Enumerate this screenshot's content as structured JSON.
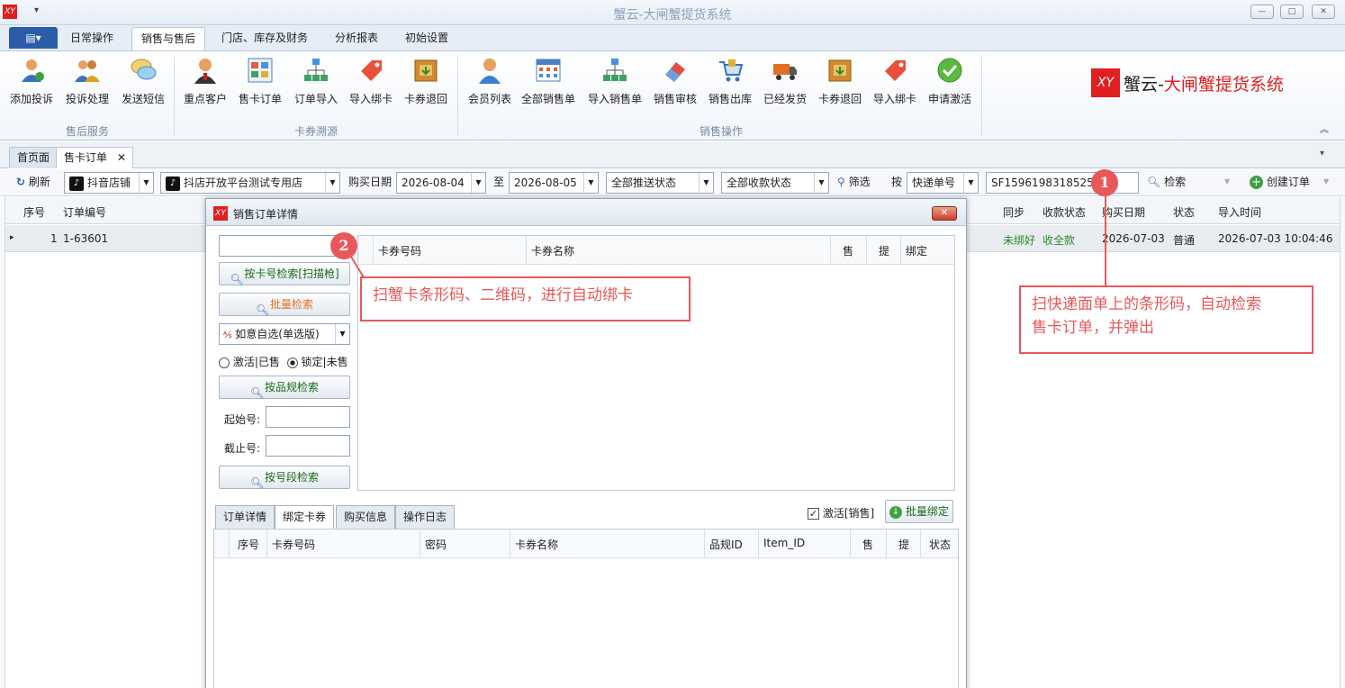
{
  "window": {
    "title": "蟹云-大闸蟹提货系统",
    "app_icon": "XY",
    "qa": "▾",
    "minimize": "—",
    "maximize": "□",
    "close": "✕"
  },
  "ribbon": {
    "file_label": "▤▾",
    "tabs": [
      "日常操作",
      "销售与售后",
      "门店、库存及财务",
      "分析报表",
      "初始设置"
    ],
    "active_tab": "销售与售后",
    "groups": [
      {
        "label": "售后服务",
        "buttons": [
          "添加投诉",
          "投诉处理",
          "发送短信"
        ]
      },
      {
        "label": "卡券溯源",
        "buttons": [
          "重点客户",
          "售卡订单",
          "订单导入",
          "导入绑卡",
          "卡券退回"
        ]
      },
      {
        "label": "销售操作",
        "buttons": [
          "会员列表",
          "全部销售单",
          "导入销售单",
          "销售审核",
          "销售出库",
          "已经发货",
          "卡券退回",
          "导入绑卡",
          "申请激活"
        ]
      }
    ],
    "brand_part1": "蟹云-",
    "brand_part2": "大闸蟹提货系统",
    "brand_logo": "XY",
    "collapse": "︽"
  },
  "doc_tabs": {
    "home": "首页面",
    "orders": "售卡订单",
    "close": "✕",
    "menu": "▾"
  },
  "filter": {
    "refresh": "刷新",
    "shop_type": "抖音店铺",
    "shop_name": "抖店开放平台测试专用店",
    "date_label": "购买日期",
    "date_from": "2026-08-04",
    "to_label": "至",
    "date_to": "2026-08-05",
    "push_status": "全部推送状态",
    "pay_status": "全部收款状态",
    "filter_btn": "筛选",
    "by_label": "按",
    "search_field": "快递单号",
    "search_value": "SF1596198318525",
    "search_btn": "检索",
    "create_btn": "创建订单"
  },
  "grid": {
    "headers": {
      "seq": "序号",
      "order_no": "订单编号",
      "sync": "同步",
      "pay": "收款状态",
      "date": "购买日期",
      "status": "状态",
      "import": "导入时间"
    },
    "rows": [
      {
        "marker": "▸",
        "seq": "1",
        "order_no": "1-63601",
        "sync": "未绑好",
        "pay": "收全款",
        "date": "2026-07-03",
        "status": "普通",
        "import": "2026-07-03 10:04:46"
      }
    ]
  },
  "dialog": {
    "title": "销售订单详情",
    "icon": "XY",
    "close": "✕",
    "search_card_btn": "按卡号检索[扫描枪]",
    "batch_search_btn": "批量检索",
    "product_select": "如意自选(单选版)",
    "radio_activated": "激活|已售",
    "radio_locked": "锁定|未售",
    "spec_search_btn": "按品规检索",
    "start_label": "起始号:",
    "end_label": "截止号:",
    "range_search_btn": "按号段检索",
    "top_table_headers": [
      "卡券号码",
      "卡券名称",
      "售",
      "提",
      "绑定"
    ],
    "bottom_tabs": [
      "订单详情",
      "绑定卡券",
      "购买信息",
      "操作日志"
    ],
    "active_bottom_tab": "绑定卡券",
    "activate_check": "激活[销售]",
    "batch_bind_btn": "批量绑定",
    "bottom_table_headers": [
      "序号",
      "卡券号码",
      "密码",
      "卡券名称",
      "品规ID",
      "Item_ID",
      "售",
      "提",
      "状态"
    ]
  },
  "annotations": {
    "badge1": "1",
    "badge2": "2",
    "callout1_line1": "扫快递面单上的条形码，自动检索",
    "callout1_line2": "售卡订单，并弹出",
    "callout2": "扫蟹卡条形码、二维码，进行自动绑卡"
  },
  "colors": {
    "accent": "#2a5ca8",
    "annotation": "#e8585a",
    "brand_red": "#e02020",
    "green_text": "#2a8a2a"
  }
}
